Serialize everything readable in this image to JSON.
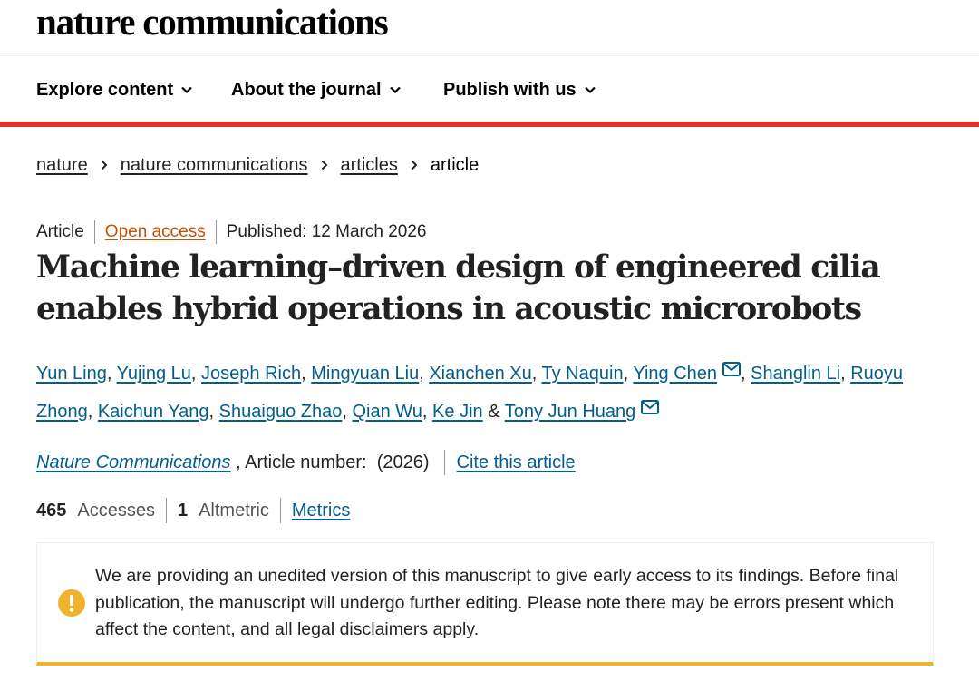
{
  "header": {
    "logo_text": "nature communications"
  },
  "nav": {
    "items": [
      {
        "label": "Explore content"
      },
      {
        "label": "About the journal"
      },
      {
        "label": "Publish with us"
      }
    ],
    "accent_color": "#e6302c"
  },
  "breadcrumb": {
    "items": [
      {
        "label": "nature"
      },
      {
        "label": "nature communications"
      },
      {
        "label": "articles"
      }
    ],
    "current": "article"
  },
  "article": {
    "type": "Article",
    "access": "Open access",
    "published": "Published: 12 March 2026",
    "title": "Machine learning–driven design of engineered cilia enables hybrid operations in acoustic microrobots",
    "authors": [
      "Yun Ling",
      "Yujing Lu",
      "Joseph Rich",
      "Mingyuan Liu",
      "Xianchen Xu",
      "Ty Naquin",
      "Ying Chen",
      "Shanglin Li",
      "Ruoyu Zhong",
      "Kaichun Yang",
      "Shuaiguo Zhao",
      "Qian Wu",
      "Ke Jin",
      "Tony Jun Huang"
    ],
    "author_separator": ", ",
    "author_last_separator": " & ",
    "journal": "Nature Communications",
    "article_number_text": " , Article number:  (2026)",
    "cite_label": "Cite this article"
  },
  "metrics": {
    "accesses_value": "465",
    "accesses_label": "Accesses",
    "altmetric_value": "1",
    "altmetric_label": "Altmetric",
    "metrics_link": "Metrics"
  },
  "notice": {
    "text": "We are providing an unedited version of this manuscript to give early access to its findings. Before final publication, the manuscript will undergo further editing. Please note there may be errors present which affect the content, and all legal disclaimers apply.",
    "accent_color": "#f0b42c",
    "icon": "warning-icon"
  },
  "colors": {
    "link": "#025e8d",
    "open_access": "#c65301"
  }
}
